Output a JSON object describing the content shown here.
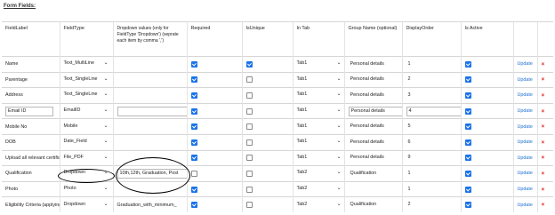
{
  "section_title": "Form Fields:",
  "headers": {
    "field_label": "FieldLabel",
    "field_type": "FieldType",
    "dropdown_values": "Dropdown values (only for FieldType 'Dropdown') (seprate each item by comma ',')",
    "required": "Required",
    "is_unique": "IsUnique",
    "in_tab": "In Tab",
    "group_name": "Group Name (optional)",
    "display_order": "DisplayOrder",
    "is_active": "Is Active"
  },
  "rows": [
    {
      "label": "Name",
      "type": "Text_MultiLine",
      "dropdown": "",
      "required": true,
      "unique": true,
      "tab": "Tab1",
      "group": "Personal details",
      "order": "1",
      "active": true,
      "update": "Update",
      "delete": "×"
    },
    {
      "label": "Parentage",
      "type": "Text_SingleLine",
      "dropdown": "",
      "required": true,
      "unique": false,
      "tab": "Tab1",
      "group": "Personal details",
      "order": "2",
      "active": true,
      "update": "Update",
      "delete": "×"
    },
    {
      "label": "Address",
      "type": "Text_SingleLine",
      "dropdown": "",
      "required": true,
      "unique": false,
      "tab": "Tab1",
      "group": "Personal details",
      "order": "3",
      "active": true,
      "update": "Update",
      "delete": "×"
    },
    {
      "label": "Email ID",
      "type": "EmailID",
      "dropdown": "",
      "required": true,
      "unique": false,
      "tab": "Tab1",
      "group": "Personal details",
      "order": "4",
      "active": true,
      "update": "Update",
      "delete": "×"
    },
    {
      "label": "Mobile No",
      "type": "Mobile",
      "dropdown": "",
      "required": true,
      "unique": false,
      "tab": "Tab1",
      "group": "Personal details",
      "order": "5",
      "active": true,
      "update": "Update",
      "delete": "×"
    },
    {
      "label": "DOB",
      "type": "Date_Field",
      "dropdown": "",
      "required": true,
      "unique": false,
      "tab": "Tab1",
      "group": "Personal details",
      "order": "6",
      "active": true,
      "update": "Update",
      "delete": "×"
    },
    {
      "label": "Upload all relevant certificat",
      "type": "File_PDF",
      "dropdown": "",
      "required": true,
      "unique": false,
      "tab": "Tab1",
      "group": "Personal details",
      "order": "9",
      "active": true,
      "update": "Update",
      "delete": "×"
    },
    {
      "label": "Qualification",
      "type": "Dropdown",
      "dropdown": "10th,12th, Graduation, Post",
      "required": false,
      "unique": false,
      "tab": "Tab2",
      "group": "Qualification",
      "order": "1",
      "active": true,
      "update": "Update",
      "delete": "×"
    },
    {
      "label": "Photo",
      "type": "Photo",
      "dropdown": "",
      "required": true,
      "unique": false,
      "tab": "Tab2",
      "group": "",
      "order": "1",
      "active": true,
      "update": "Update",
      "delete": "×"
    },
    {
      "label": "Eligibility Criteria (applying",
      "type": "Dropdown",
      "dropdown": "Graduation_with_minimum_",
      "required": true,
      "unique": false,
      "tab": "Tab2",
      "group": "Qualification",
      "order": "2",
      "active": true,
      "update": "Update",
      "delete": "×"
    }
  ],
  "icons": {
    "select_arrow": "chevron-down-icon",
    "delete": "close-icon"
  },
  "colors": {
    "link": "#1f6fd1",
    "delete": "#d92424",
    "checkbox_on": "#1a73e8"
  }
}
